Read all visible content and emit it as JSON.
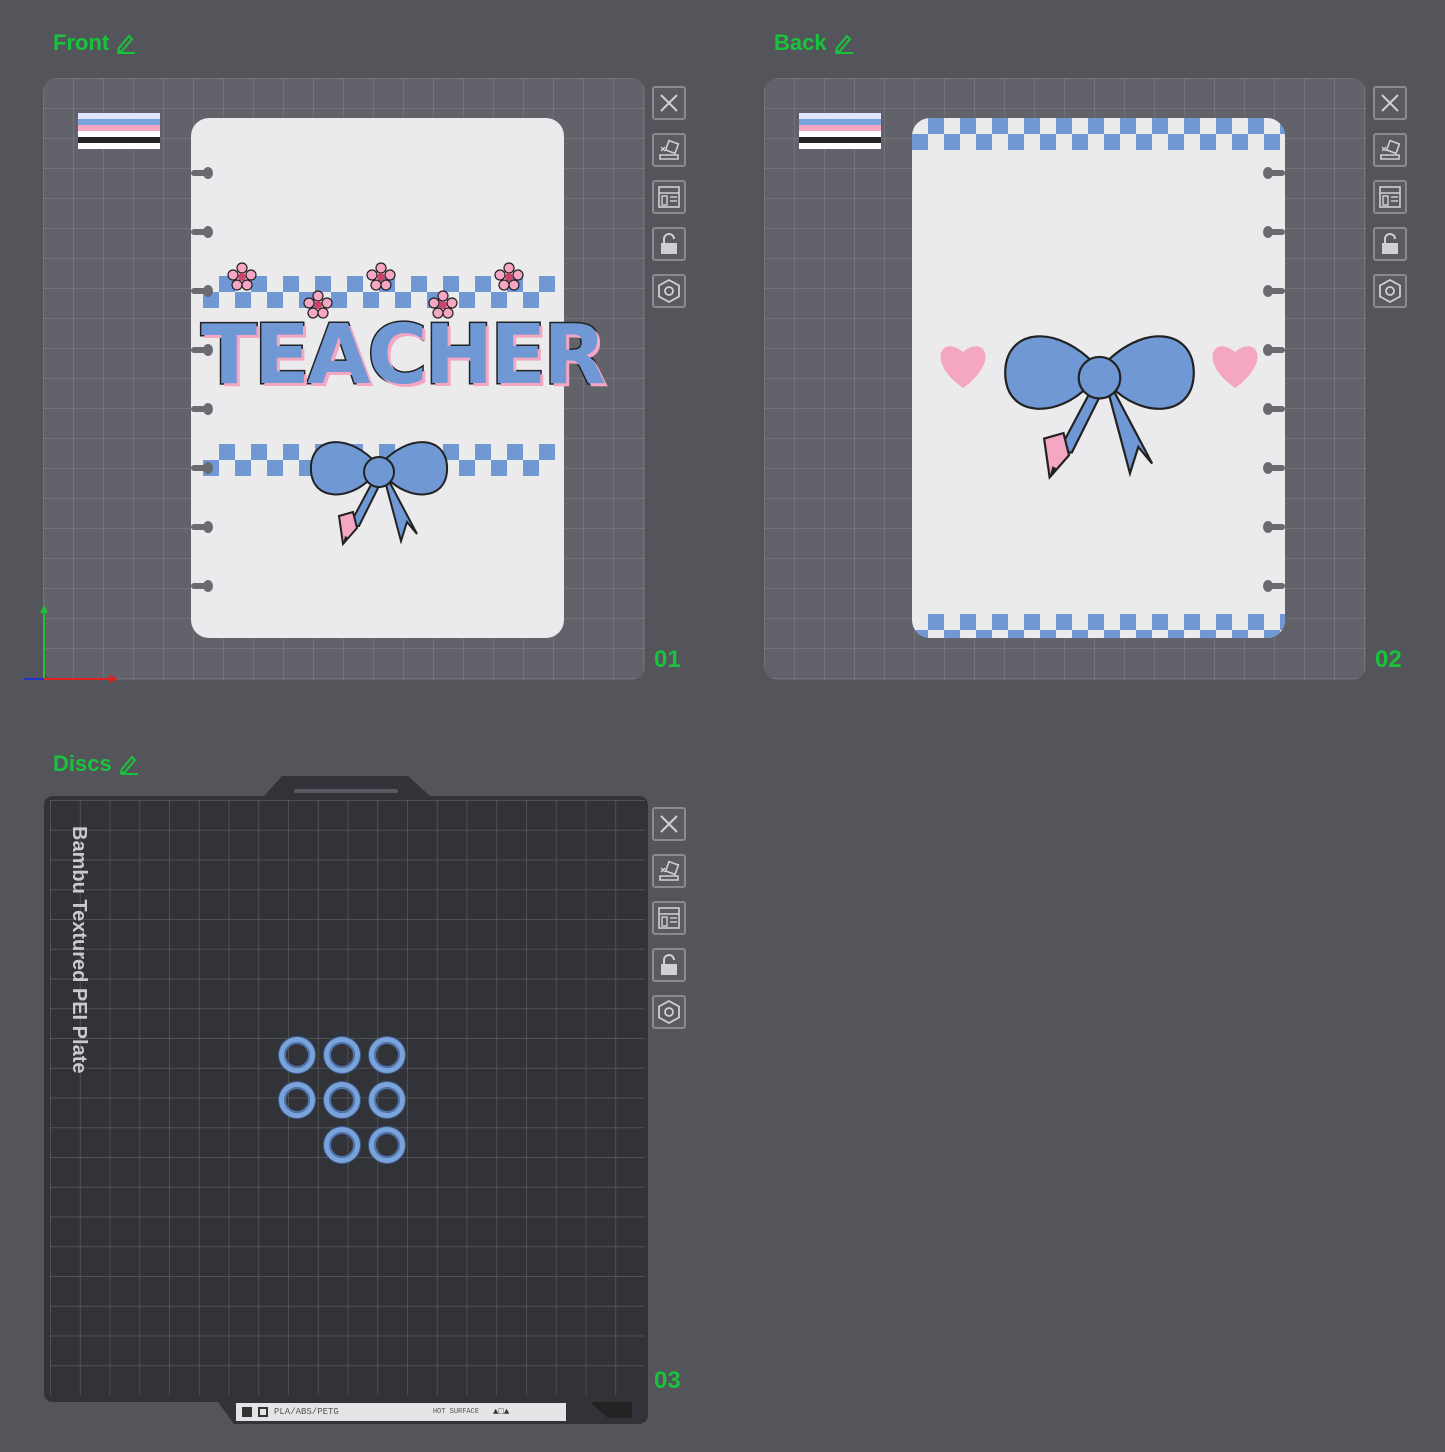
{
  "plates": [
    {
      "title": "Front",
      "number": "01"
    },
    {
      "title": "Back",
      "number": "02"
    },
    {
      "title": "Discs",
      "number": "03"
    }
  ],
  "front_card": {
    "text": "TEACHER"
  },
  "disc_plate": {
    "label": "Bambu Textured PEI Plate",
    "footer_material": "PLA/ABS/PETG",
    "footer_hot": "HOT SURFACE"
  },
  "toolbar_icons": [
    "close-icon",
    "auto-orient-icon",
    "arrange-icon",
    "lock-icon",
    "settings-icon"
  ],
  "colors": {
    "accent": "#19c23c",
    "background": "#54555a",
    "bed": "#62636a",
    "disc_bed": "#323338",
    "blue": "#6f98d4",
    "pink": "#f4a6c2"
  }
}
